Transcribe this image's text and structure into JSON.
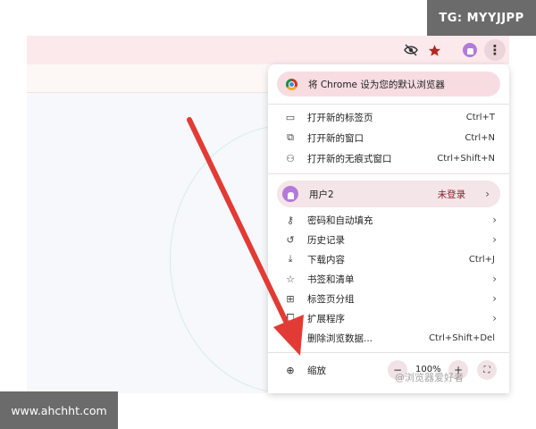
{
  "overlay": {
    "tg_label": "TG: MYYJJPP",
    "site_label": "www.ahchht.com",
    "watermark": "@浏览器爱好者"
  },
  "toolbar": {
    "icons": [
      "eye-off-icon",
      "star-icon",
      "profile-avatar-icon",
      "kebab-menu-icon"
    ],
    "star_color": "#b3261e"
  },
  "menu": {
    "default_banner": "将 Chrome 设为您的默认浏览器",
    "group1": [
      {
        "label": "打开新的标签页",
        "shortcut": "Ctrl+T",
        "icon": "new-tab-icon"
      },
      {
        "label": "打开新的窗口",
        "shortcut": "Ctrl+N",
        "icon": "new-window-icon"
      },
      {
        "label": "打开新的无痕式窗口",
        "shortcut": "Ctrl+Shift+N",
        "icon": "incognito-icon"
      }
    ],
    "user": {
      "name": "用户2",
      "status": "未登录"
    },
    "group2": [
      {
        "label": "密码和自动填充",
        "icon": "key-icon",
        "arrow": "›"
      },
      {
        "label": "历史记录",
        "icon": "history-icon",
        "arrow": "›"
      },
      {
        "label": "下载内容",
        "shortcut": "Ctrl+J",
        "icon": "download-icon"
      },
      {
        "label": "书签和清单",
        "icon": "star-outline-icon",
        "arrow": "›"
      },
      {
        "label": "标签页分组",
        "icon": "grid-icon",
        "arrow": "›"
      },
      {
        "label": "扩展程序",
        "icon": "puzzle-icon",
        "arrow": "›"
      },
      {
        "label": "删除浏览数据...",
        "shortcut": "Ctrl+Shift+Del",
        "icon": "trash-icon"
      }
    ],
    "zoom": {
      "label": "缩放",
      "value": "100%",
      "minus": "−",
      "plus": "+"
    }
  },
  "colors": {
    "accent_arrow": "#e23b35",
    "banner_bg": "#f7dde2",
    "user_status": "#8a1c2b"
  }
}
